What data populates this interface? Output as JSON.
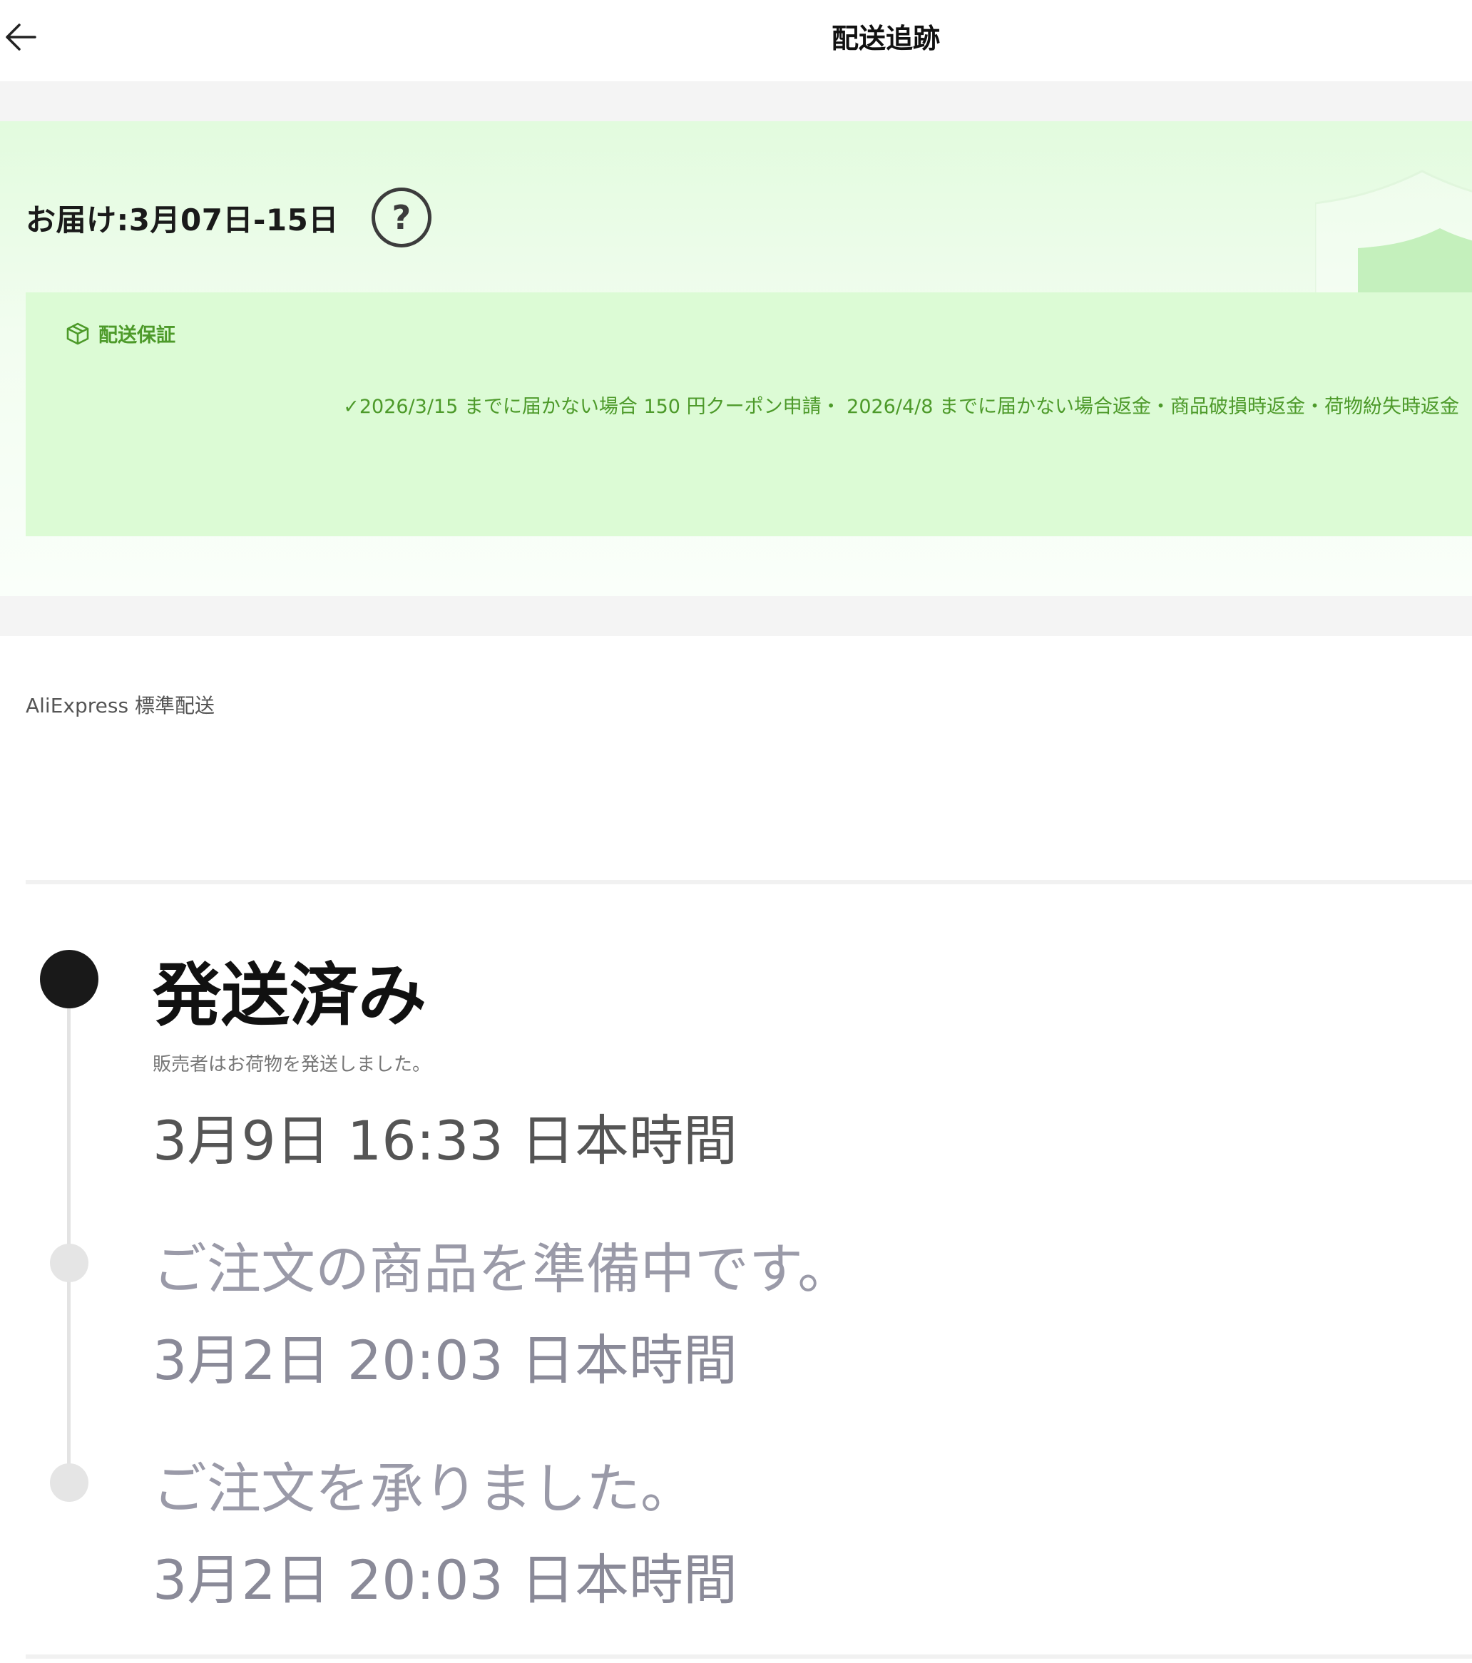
{
  "header": {
    "title": "配送追跡",
    "back_icon": "arrow-left-icon"
  },
  "delivery": {
    "estimate": "お届け:3月07日-15日",
    "help_label": "?",
    "help_icon": "question-circle-icon",
    "guarantee": {
      "title": "配送保証",
      "icon": "package-box-icon",
      "detail": "✓2026/3/15 までに届かない場合 150 円クーポン申請・ 2026/4/8 までに届かない場合返金・商品破損時返金・荷物紛失時返金"
    }
  },
  "shipping": {
    "method": "AliExpress 標準配送"
  },
  "timeline": [
    {
      "status": "発送済み",
      "description": "販売者はお荷物を発送しました。",
      "time": "3月9日 16:33 日本時間",
      "active": true
    },
    {
      "status": "ご注文の商品を準備中です。",
      "time": "3月2日 20:03 日本時間",
      "active": false
    },
    {
      "status": "ご注文を承りました。",
      "time": "3月2日 20:03 日本時間",
      "active": false
    }
  ],
  "colors": {
    "guarantee_green": "#4d9a2a",
    "guarantee_bg": "#dcfbd5",
    "active_dot": "#191919",
    "inactive_dot": "#e5e5e5"
  }
}
